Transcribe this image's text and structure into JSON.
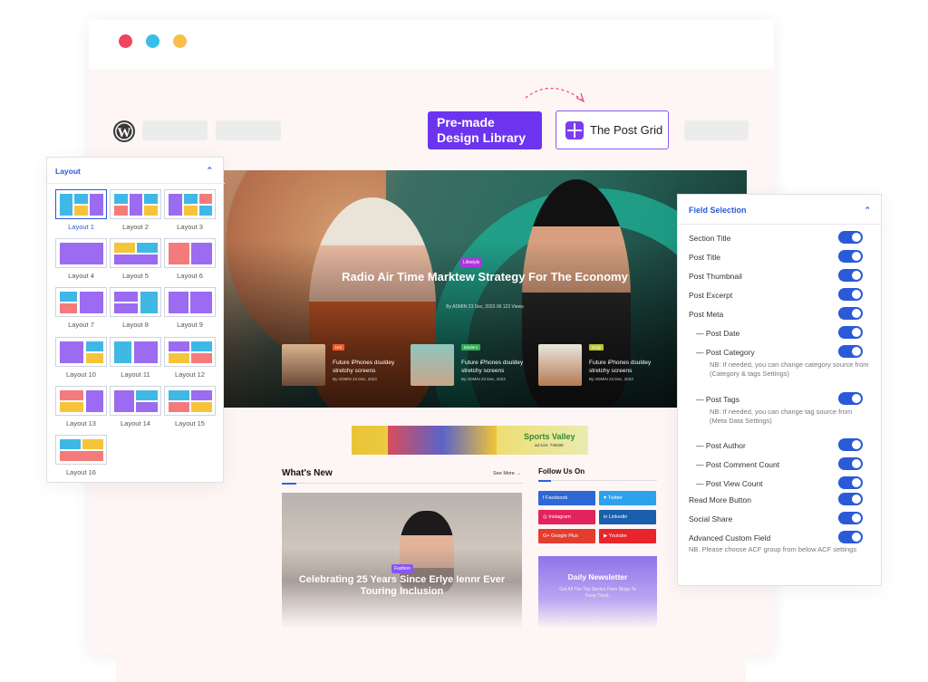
{
  "toolbar": {
    "premade_label": "Pre-made Design Library",
    "postgrid_label": "The Post Grid",
    "wp_logo": "W"
  },
  "hero": {
    "badge": "Lifestyle",
    "title": "Radio Air Time Marktew Strategy For The Economy",
    "meta": "By ADMIN    23 Dec, 2023    00    123 Views",
    "minis": [
      {
        "badge": "Hot",
        "title": "Future iPhones dsuldey stretchy screens",
        "meta": "By ADMIN    23 Dec, 2023"
      },
      {
        "badge": "Modern",
        "title": "Future iPhones dsuldey stretchy screens",
        "meta": "By ADMIN    23 Dec, 2023"
      },
      {
        "badge": "Daily",
        "title": "Future iPhones dsuldey stretchy screens",
        "meta": "By ADMIN    23 Dec, 2023"
      }
    ]
  },
  "ad": {
    "title": "Sports Valley",
    "size": "ad size: 740x90"
  },
  "whats_new": {
    "title": "What's New",
    "see_more": "See More →",
    "feature_badge": "Fashion",
    "feature_title": "Celebrating 25 Years Since Erlye Iennr Ever Touring Inclusion"
  },
  "follow": {
    "title": "Follow Us On",
    "buttons": [
      {
        "label": "f  Facebook",
        "color": "#2d68d4"
      },
      {
        "label": "♥  Twitter",
        "color": "#2ea1ee"
      },
      {
        "label": "◎  Instagram",
        "color": "#e3235e"
      },
      {
        "label": "in  Linkedin",
        "color": "#1a5fae"
      },
      {
        "label": "G+  Google Plus",
        "color": "#e43d2f"
      },
      {
        "label": "▶  Youtube",
        "color": "#e8252a"
      }
    ]
  },
  "newsletter": {
    "title": "Daily Newsletter",
    "subtitle": "Get All The Top Stories From Blogs To Keep Track."
  },
  "layout_panel": {
    "title": "Layout",
    "items": [
      "Layout 1",
      "Layout 2",
      "Layout 3",
      "Layout 4",
      "Layout 5",
      "Layout 6",
      "Layout 7",
      "Layout 8",
      "Layout 9",
      "Layout 10",
      "Layout 11",
      "Layout 12",
      "Layout 13",
      "Layout 14",
      "Layout 15",
      "Layout 16"
    ]
  },
  "field_panel": {
    "title": "Field Selection",
    "fields": {
      "section_title": "Section Title",
      "post_title": "Post Title",
      "post_thumbnail": "Post Thumbnail",
      "post_excerpt": "Post Excerpt",
      "post_meta": "Post Meta",
      "post_date": "— Post Date",
      "post_category": "— Post Category",
      "category_note": "NB: If needed, you can change category source from (Category & tags Settings)",
      "post_tags": "— Post Tags",
      "tags_note": "NB: If needed, you can change tag source from (Meta Data Settings)",
      "post_author": "— Post Author",
      "post_comment_count": "— Post Comment Count",
      "post_view_count": "— Post View Count",
      "read_more": "Read More Button",
      "social_share": "Social Share",
      "acf": "Advanced Custom Field",
      "acf_note": "NB. Please choose ACF group from below ACF settings"
    }
  }
}
